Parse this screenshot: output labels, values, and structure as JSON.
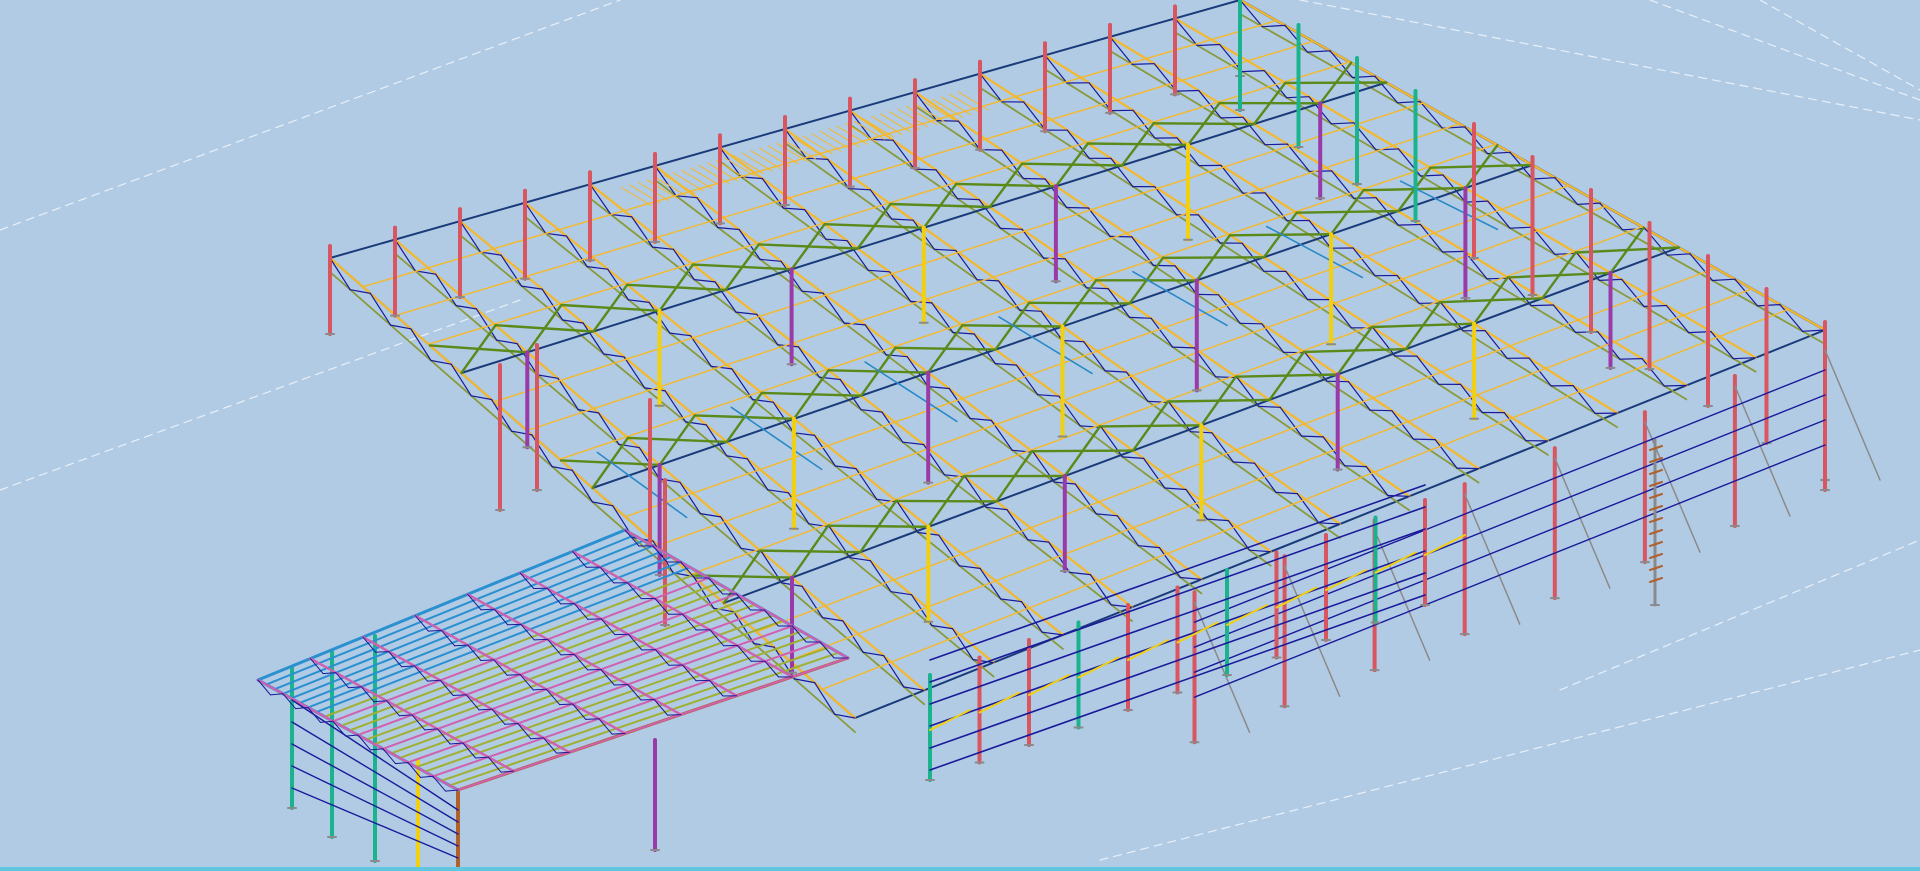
{
  "viewport": {
    "view": "3d-model-view",
    "background_color": "#b1cbe5",
    "border_color": "#5fc8e0"
  },
  "model": {
    "member_colors": {
      "column_primary": "#d95560",
      "column_secondary": "#9a3aa8",
      "column_tertiary": "#1ab38e",
      "column_accent": "#f0d010",
      "column_brown": "#b0602a",
      "truss_chord": "#f5b82a",
      "truss_web": "#1a1a9a",
      "truss_web_alt": "#8a9a3a",
      "bracing_main": "#5a8a1a",
      "bracing_secondary": "#2a8ac8",
      "roof_edge": "#1a3a7a",
      "canopy_purlin_blue": "#2a90d0",
      "canopy_purlin_green": "#a0b030",
      "canopy_purlin_pink": "#d060b0",
      "side_girt": "#1a1a9a",
      "grey_bracing": "#8a8a8a",
      "dimension_line": "#e8f0f8"
    }
  }
}
